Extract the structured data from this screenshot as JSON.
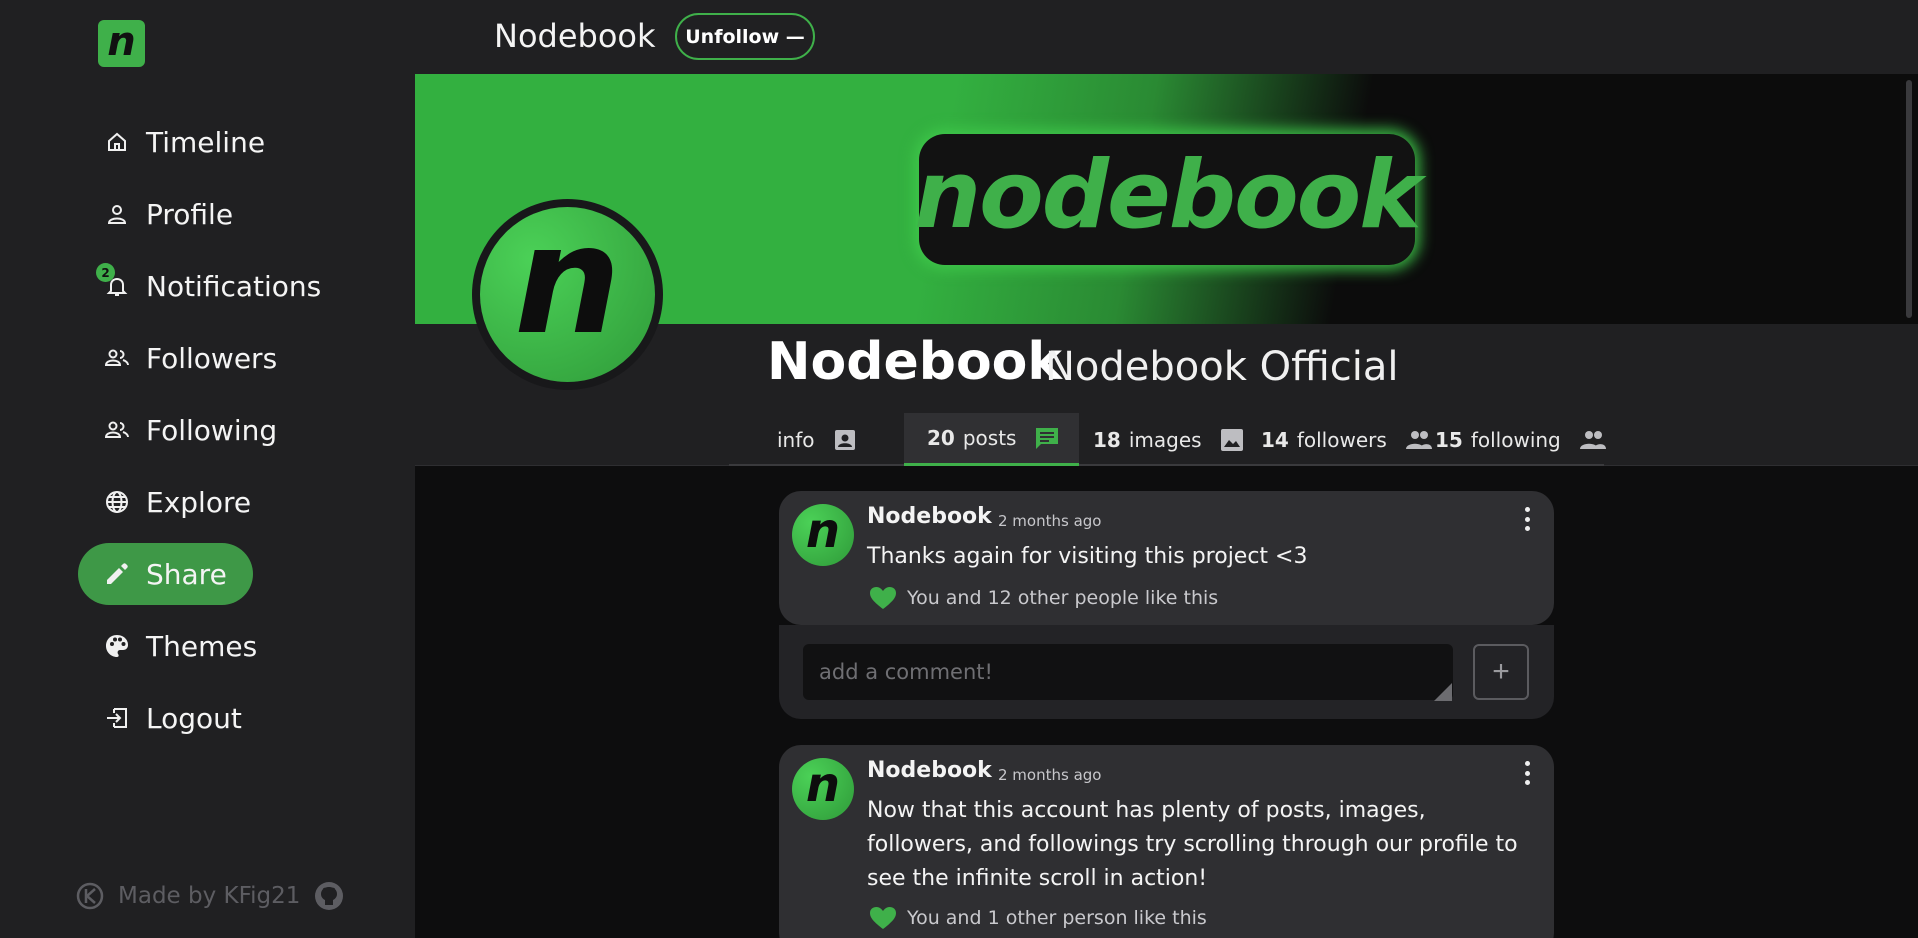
{
  "app": {
    "logo_letter": "n",
    "banner_text": "nodebook",
    "brand_color": "#3fb04a"
  },
  "sidebar": {
    "items": [
      {
        "label": "Timeline",
        "icon": "home-icon"
      },
      {
        "label": "Profile",
        "icon": "person-icon"
      },
      {
        "label": "Notifications",
        "icon": "bell-icon",
        "badge": "2"
      },
      {
        "label": "Followers",
        "icon": "people-icon"
      },
      {
        "label": "Following",
        "icon": "people-icon"
      },
      {
        "label": "Explore",
        "icon": "globe-icon"
      },
      {
        "label": "Share",
        "icon": "pencil-icon"
      },
      {
        "label": "Themes",
        "icon": "palette-icon"
      },
      {
        "label": "Logout",
        "icon": "logout-icon"
      }
    ],
    "footer": "Made by KFig21"
  },
  "header": {
    "title": "Nodebook",
    "unfollow_label": "Unfollow —"
  },
  "profile": {
    "avatar_letter": "n",
    "display_name": "Nodebook",
    "official_name": "Nodebook Official",
    "tabs": [
      {
        "count": "",
        "label": "info",
        "icon": "contact-card-icon"
      },
      {
        "count": "20",
        "label": "posts",
        "icon": "chat-icon"
      },
      {
        "count": "18",
        "label": "images",
        "icon": "image-icon"
      },
      {
        "count": "14",
        "label": "followers",
        "icon": "people-icon"
      },
      {
        "count": "15",
        "label": "following",
        "icon": "people-icon"
      }
    ]
  },
  "posts": [
    {
      "author": "Nodebook",
      "time": "2 months ago",
      "text": "Thanks again for visiting this project <3",
      "likes": "You and 12 other people like this"
    },
    {
      "author": "Nodebook",
      "time": "2 months ago",
      "text": "Now that this account has plenty of posts, images, followers, and followings try scrolling through our profile to see the infinite scroll in action!",
      "likes": "You and 1 other person like this"
    }
  ],
  "comment": {
    "placeholder": "add a comment!",
    "add_label": "+"
  }
}
